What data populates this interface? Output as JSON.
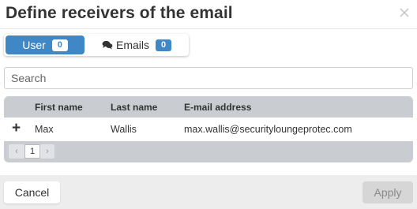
{
  "dialog": {
    "title": "Define receivers of the email"
  },
  "tabs": [
    {
      "label": "User",
      "count": "0",
      "active": true
    },
    {
      "label": "Emails",
      "count": "0",
      "icon": "comments-icon",
      "active": false
    }
  ],
  "search": {
    "placeholder": "Search",
    "value": ""
  },
  "table": {
    "columns": [
      "First name",
      "Last name",
      "E-mail address"
    ],
    "rows": [
      {
        "first_name": "Max",
        "last_name": "Wallis",
        "email": "max.wallis@securityloungeprotec.com"
      }
    ]
  },
  "pager": {
    "prev": "‹",
    "current_page": "1",
    "next": "›"
  },
  "footer": {
    "cancel_label": "Cancel",
    "apply_label": "Apply"
  },
  "colors": {
    "accent": "#3f87c5",
    "grid_header": "#c9ccd1",
    "footer_bg": "#ededed",
    "apply_disabled_bg": "#d6d6d6"
  }
}
